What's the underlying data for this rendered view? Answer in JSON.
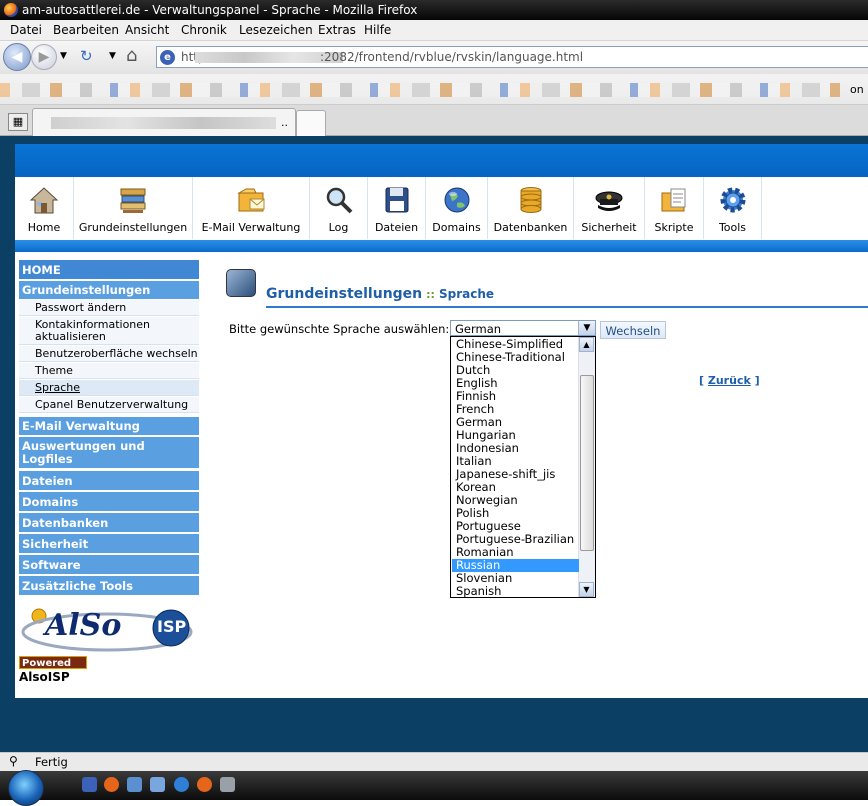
{
  "window": {
    "title": "am-autosattlerei.de - Verwaltungspanel - Sprache - Mozilla Firefox"
  },
  "menu": [
    "Datei",
    "Bearbeiten",
    "Ansicht",
    "Chronik",
    "Lesezeichen",
    "Extras",
    "Hilfe"
  ],
  "url": {
    "suffix": ":2082/frontend/rvblue/rvskin/language.html",
    "prefix": "http://"
  },
  "tab": {
    "suffix": ".."
  },
  "toolbar": [
    {
      "label": "Home",
      "icon": "home-icon"
    },
    {
      "label": "Grundeinstellungen",
      "icon": "settings-books-icon"
    },
    {
      "label": "E-Mail Verwaltung",
      "icon": "mail-folder-icon"
    },
    {
      "label": "Log",
      "icon": "magnifier-icon"
    },
    {
      "label": "Dateien",
      "icon": "floppy-disk-icon"
    },
    {
      "label": "Domains",
      "icon": "globe-icon"
    },
    {
      "label": "Datenbanken",
      "icon": "database-icon"
    },
    {
      "label": "Sicherheit",
      "icon": "police-cap-icon"
    },
    {
      "label": "Skripte",
      "icon": "script-folder-icon"
    },
    {
      "label": "Tools",
      "icon": "gear-icon"
    }
  ],
  "sidebar": {
    "home": "HOME",
    "grund": "Grundeinstellungen",
    "items": [
      "Passwort ändern",
      "Kontakinformationen aktualisieren",
      "Benutzeroberfläche wechseln",
      "Theme",
      "Sprache",
      "Cpanel Benutzerverwaltung"
    ],
    "sections": [
      "E-Mail Verwaltung",
      "Auswertungen und Logfiles",
      "Dateien",
      "Domains",
      "Datenbanken",
      "Sicherheit",
      "Software",
      "Zusätzliche Tools"
    ]
  },
  "branding": {
    "logo_text": "AlSo",
    "logo_badge": "ISP",
    "powered": "Powered By",
    "name": "AlsoISP"
  },
  "content": {
    "heading": "Grundeinstellungen",
    "separator": "::",
    "subheading": "Sprache",
    "label": "Bitte gewünschte Sprache auswählen:",
    "selected": "German",
    "button": "Wechseln",
    "back_open": "[",
    "back": "Zurück",
    "back_close": "]"
  },
  "languages": [
    "Chinese-Simplified",
    "Chinese-Traditional",
    "Dutch",
    "English",
    "Finnish",
    "French",
    "German",
    "Hungarian",
    "Indonesian",
    "Italian",
    "Japanese-shift_jis",
    "Korean",
    "Norwegian",
    "Polish",
    "Portuguese",
    "Portuguese-Brazilian",
    "Romanian",
    "Russian",
    "Slovenian",
    "Spanish"
  ],
  "highlighted_language": "Russian",
  "status": {
    "text": "Fertig"
  },
  "colors": {
    "accent": "#0a6cc9",
    "sidebar_header": "#5a9fe0",
    "selection": "#3399ff"
  }
}
